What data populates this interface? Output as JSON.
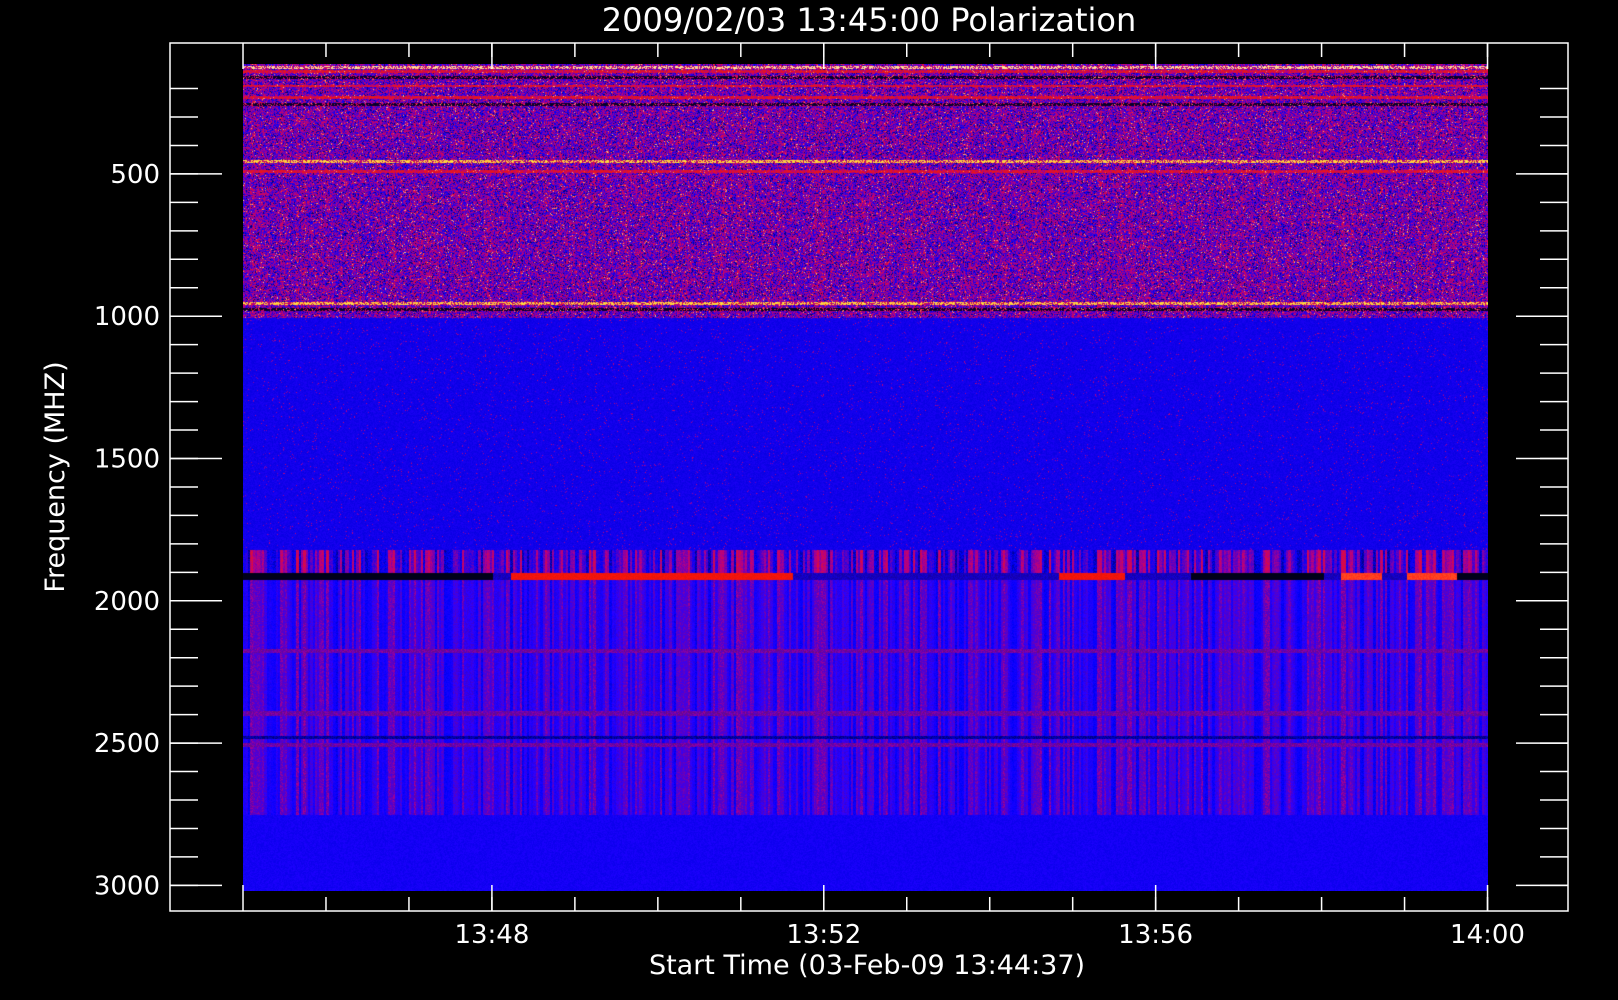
{
  "chart_data": {
    "type": "heatmap",
    "title": "2009/02/03 13:45:00 Polarization",
    "xlabel": "Start Time (03-Feb-09 13:44:37)",
    "ylabel": "Frequency (MHZ)",
    "x_axis": {
      "unit": "minutes after 13:44:37",
      "range": [
        -0.5,
        16.35
      ],
      "data_range": [
        0.38,
        15.38
      ],
      "major_ticks": [
        {
          "value": 0.38,
          "label": ""
        },
        {
          "value": 3.38,
          "label": "13:48"
        },
        {
          "value": 7.38,
          "label": "13:52"
        },
        {
          "value": 11.38,
          "label": "13:56"
        },
        {
          "value": 15.38,
          "label": "14:00"
        }
      ],
      "minor_step": 1
    },
    "y_axis": {
      "unit": "MHz",
      "reversed": true,
      "range": [
        40,
        3090
      ],
      "data_range": [
        115,
        3020
      ],
      "major_ticks": [
        500,
        1000,
        1500,
        2000,
        2500,
        3000
      ],
      "minor_step": 100
    },
    "colorscale": [
      "#000000",
      "#0a00ff",
      "#ff1a00",
      "#ffffff"
    ],
    "bands": [
      {
        "f0": 115,
        "f1": 1005,
        "style": "noisy"
      },
      {
        "f0": 1005,
        "f1": 1820,
        "style": "quiet"
      },
      {
        "f0": 1820,
        "f1": 1900,
        "style": "striped"
      },
      {
        "f0": 1900,
        "f1": 1925,
        "style": "emission"
      },
      {
        "f0": 1925,
        "f1": 2750,
        "style": "mixed"
      },
      {
        "f0": 2750,
        "f1": 3020,
        "style": "smooth"
      }
    ],
    "emission_segments": [
      {
        "t0": 0.38,
        "t1": 3.38,
        "level": "dark"
      },
      {
        "t0": 3.6,
        "t1": 7.0,
        "level": "red"
      },
      {
        "t0": 10.2,
        "t1": 11.0,
        "level": "red"
      },
      {
        "t0": 11.8,
        "t1": 13.4,
        "level": "dark"
      },
      {
        "t0": 13.6,
        "t1": 14.1,
        "level": "bright"
      },
      {
        "t0": 14.4,
        "t1": 15.0,
        "level": "bright"
      },
      {
        "t0": 15.0,
        "t1": 15.38,
        "level": "dark"
      }
    ],
    "grid": false
  }
}
